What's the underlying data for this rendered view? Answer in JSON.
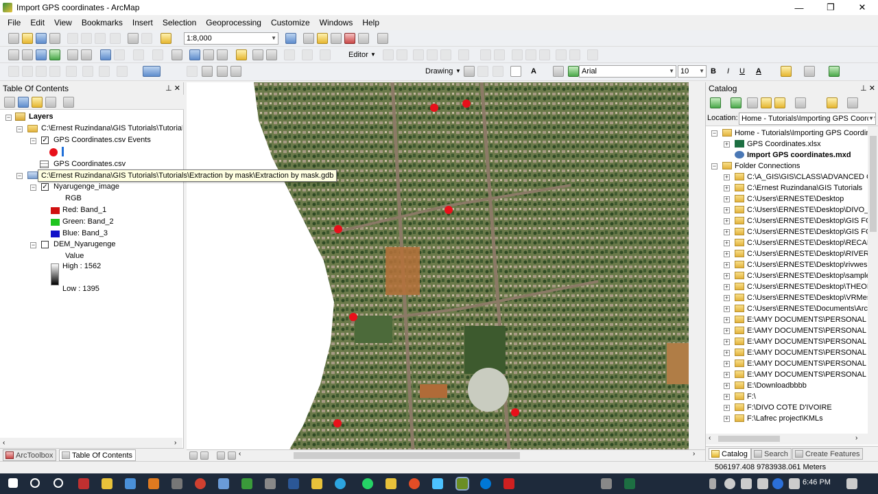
{
  "window": {
    "title": "Import GPS coordinates - ArcMap"
  },
  "menu": [
    "File",
    "Edit",
    "View",
    "Bookmarks",
    "Insert",
    "Selection",
    "Geoprocessing",
    "Customize",
    "Windows",
    "Help"
  ],
  "toolbar": {
    "scale_value": "1:8,000",
    "editor_label": "Editor",
    "drawing_label": "Drawing",
    "font_name": "Arial",
    "font_size": "10",
    "bold": "B",
    "italic": "I",
    "underline": "U",
    "font_color_label": "A"
  },
  "toc": {
    "title": "Table Of Contents",
    "layers_label": "Layers",
    "workspace1_path": "C:\\Ernest Ruzindana\\GIS Tutorials\\Tutorials",
    "gps_events_label": "GPS Coordinates.csv Events",
    "gps_csv_label": "GPS Coordinates.csv",
    "workspace2_path": "C:\\Ernest Ruzindana\\GIS Tutorials\\Tutorials\\Extraction by mask\\Extraction by mask.gdb",
    "image_layer_label": "Nyarugenge_image",
    "rgb_label": "RGB",
    "red_label": "Red:    Band_1",
    "green_label": "Green:  Band_2",
    "blue_label": "Blue:    Band_3",
    "dem_label": "DEM_Nyarugenge",
    "value_label": "Value",
    "high_label": "High : 1562",
    "low_label": "Low : 1395",
    "tooltip": "C:\\Ernest Ruzindana\\GIS Tutorials\\Tutorials\\Extraction by mask\\Extraction by mask.gdb",
    "tabs": [
      "ArcToolbox",
      "Table Of Contents"
    ]
  },
  "catalog": {
    "title": "Catalog",
    "location_label": "Location:",
    "location_value": "Home - Tutorials\\Importing GPS Coordinates",
    "items": [
      {
        "label": "Home - Tutorials\\Importing GPS Coordinates",
        "level": 0,
        "type": "home"
      },
      {
        "label": "GPS Coordinates.xlsx",
        "level": 1,
        "type": "xlsx"
      },
      {
        "label": "Import GPS coordinates.mxd",
        "level": 1,
        "type": "mxd"
      },
      {
        "label": "Folder Connections",
        "level": 0,
        "type": "folder"
      },
      {
        "label": "C:\\A_GIS\\GIS\\CLASS\\ADVANCED GIS",
        "level": 1,
        "type": "folder"
      },
      {
        "label": "C:\\Ernest Ruzindana\\GIS Tutorials",
        "level": 1,
        "type": "folder"
      },
      {
        "label": "C:\\Users\\ERNESTE\\Desktop",
        "level": 1,
        "type": "folder"
      },
      {
        "label": "C:\\Users\\ERNESTE\\Desktop\\DIVO_p",
        "level": 1,
        "type": "folder"
      },
      {
        "label": "C:\\Users\\ERNESTE\\Desktop\\GIS FO",
        "level": 1,
        "type": "folder"
      },
      {
        "label": "C:\\Users\\ERNESTE\\Desktop\\GIS FO",
        "level": 1,
        "type": "folder"
      },
      {
        "label": "C:\\Users\\ERNESTE\\Desktop\\RECAP",
        "level": 1,
        "type": "folder"
      },
      {
        "label": "C:\\Users\\ERNESTE\\Desktop\\RIVERS",
        "level": 1,
        "type": "folder"
      },
      {
        "label": "C:\\Users\\ERNESTE\\Desktop\\rivwes",
        "level": 1,
        "type": "folder"
      },
      {
        "label": "C:\\Users\\ERNESTE\\Desktop\\sample",
        "level": 1,
        "type": "folder"
      },
      {
        "label": "C:\\Users\\ERNESTE\\Desktop\\THEOD",
        "level": 1,
        "type": "folder"
      },
      {
        "label": "C:\\Users\\ERNESTE\\Desktop\\VRMes",
        "level": 1,
        "type": "folder"
      },
      {
        "label": "C:\\Users\\ERNESTE\\Documents\\Arc",
        "level": 1,
        "type": "folder"
      },
      {
        "label": "E:\\AMY DOCUMENTS\\PERSONAL D",
        "level": 1,
        "type": "folder"
      },
      {
        "label": "E:\\AMY DOCUMENTS\\PERSONAL D",
        "level": 1,
        "type": "folder"
      },
      {
        "label": "E:\\AMY DOCUMENTS\\PERSONAL D",
        "level": 1,
        "type": "folder"
      },
      {
        "label": "E:\\AMY DOCUMENTS\\PERSONAL D",
        "level": 1,
        "type": "folder"
      },
      {
        "label": "E:\\AMY DOCUMENTS\\PERSONAL D",
        "level": 1,
        "type": "folder"
      },
      {
        "label": "E:\\AMY DOCUMENTS\\PERSONAL D",
        "level": 1,
        "type": "folder"
      },
      {
        "label": "E:\\Downloadbbbb",
        "level": 1,
        "type": "folder"
      },
      {
        "label": "F:\\",
        "level": 1,
        "type": "folder"
      },
      {
        "label": "F:\\DIVO COTE D'IVOIRE",
        "level": 1,
        "type": "folder"
      },
      {
        "label": "F:\\Lafrec project\\KMLs",
        "level": 1,
        "type": "folder"
      }
    ],
    "tabs": [
      "Catalog",
      "Search",
      "Create Features"
    ]
  },
  "status": {
    "coords": "506197.408  9783938.061 Meters"
  },
  "taskbar": {
    "time": "6:46 PM"
  },
  "colors": {
    "gps_point": "#e8101a",
    "red_band": "#d01010",
    "green_band": "#1ec41e",
    "blue_band": "#1010c8"
  }
}
